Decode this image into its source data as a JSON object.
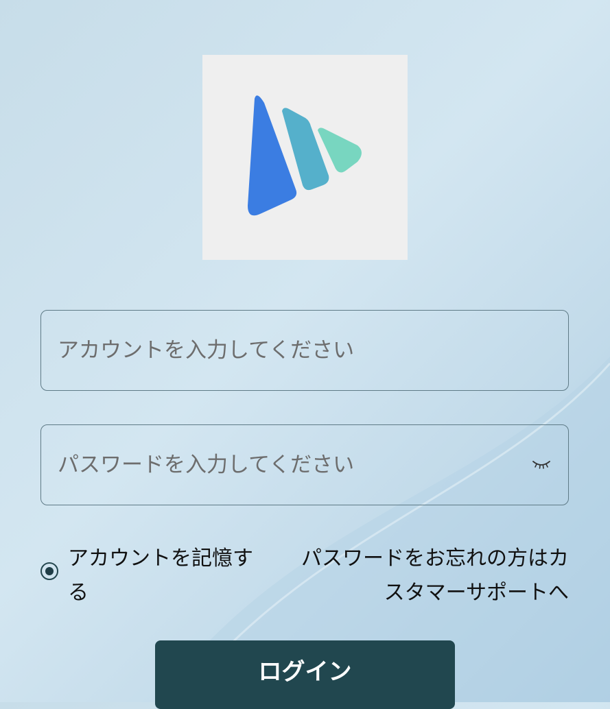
{
  "login_form": {
    "account": {
      "value": "",
      "placeholder": "アカウントを入力してください"
    },
    "password": {
      "value": "",
      "placeholder": "パスワードを入力してください",
      "toggle_icon": "eye-closed-icon"
    },
    "remember": {
      "label": "アカウントを記憶する",
      "checked": true
    },
    "forgot_password": {
      "line1": "パスワードをお忘れの方はカ",
      "line2": "スタマーサポートへ"
    },
    "login_button": {
      "label": "ログイン"
    }
  },
  "logo": {
    "icon": "app-logo-icon",
    "colors": [
      "#3b7de2",
      "#55b0cb",
      "#78d6c0"
    ]
  },
  "theme": {
    "button_color": "#21474f",
    "border_color": "#5e7a86"
  }
}
